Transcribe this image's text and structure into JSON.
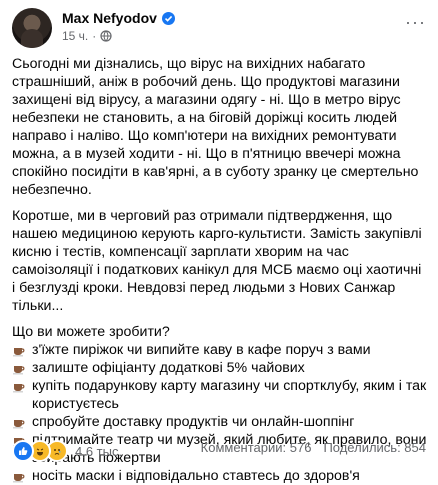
{
  "post": {
    "author": "Max Nefyodov",
    "time": "15 ч.",
    "dot": "·",
    "more": "···"
  },
  "body": {
    "p1": "Сьогодні ми дізнались, що вірус на вихідних набагато страшніший, аніж в робочий день. Що продуктові магазини захищені від вірусу, а магазини одягу - ні. Що в метро вірус небезпеки не становить, а на біговій доріжці косить людей направо і наліво. Що комп'ютери на вихідних ремонтувати можна, а в музей ходити - ні. Що в п'ятницю ввечері можна спокійно посидіти в кав'ярні, а в суботу зранку це смертельно небезпечно.",
    "p2": "Коротше, ми в черговий раз отримали підтвердження, що нашею медициною керують карго-культисти. Замість закупівлі кисню і тестів, компенсації зарплати хворим на час самоізоляції і податкових канікул для МСБ маємо оці хаотичні і безглузді кроки. Невдовзі перед людьми з Нових Санжар тільки...",
    "q": "Що ви можете зробити?",
    "items": [
      "з'їжте пиріжок чи випийте каву в кафе поруч з вами",
      "залиште офіціанту додаткові 5% чайових",
      "купіть подарункову карту магазину чи спортклубу, яким і так користуєтесь",
      "спробуйте доставку продуктів чи онлайн-шоппінг",
      "підтримайте театр чи музей, який любите, як правило, вони збирають пожертви",
      "носіть маски і відповідально ставтесь до здоров'я"
    ]
  },
  "footer": {
    "reactions_count": "4,6 тыс.",
    "comments": "Комментарии: 576",
    "shares": "Поделились: 854"
  },
  "colors": {
    "accent": "#1877f2",
    "secondary_text": "#65676b"
  }
}
